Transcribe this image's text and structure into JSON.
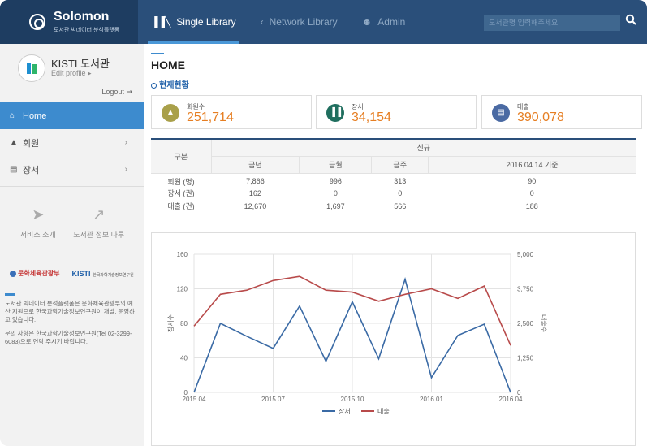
{
  "brand": {
    "title": "Solomon",
    "subtitle": "도서관 빅데이터 분석플랫폼"
  },
  "topnav": {
    "items": [
      {
        "label": "Single Library",
        "icon": "library-books-icon",
        "active": true
      },
      {
        "label": "Network Library",
        "icon": "share-icon",
        "active": false
      },
      {
        "label": "Admin",
        "icon": "user-settings-icon",
        "active": false
      }
    ],
    "search_placeholder": "도서관명 입력해주세요"
  },
  "profile": {
    "name": "KISTI 도서관",
    "edit_label": "Edit profile ▸",
    "logout_label": "Logout"
  },
  "sidebar": {
    "menu": [
      {
        "label": "Home",
        "icon": "home-icon",
        "active": true
      },
      {
        "label": "회원",
        "icon": "user-icon",
        "active": false
      },
      {
        "label": "장서",
        "icon": "book-icon",
        "active": false
      }
    ],
    "quicklinks": [
      {
        "label": "서비스 소개",
        "icon": "paper-plane-icon"
      },
      {
        "label": "도서관 정보 나루",
        "icon": "external-link-icon"
      }
    ],
    "partners": {
      "ministry": "문화체육관광부",
      "kisti": "KISTI",
      "kisti_full": "한국과학기술정보연구원"
    },
    "info": [
      "도서관 빅데이터 분석플랫폼은 문화체육관광부의 예산 지원으로 한국과학기술정보연구원이 개발, 운영하고 있습니다.",
      "문의 사항은 한국과학기술정보연구원(Tel 02-3299-6083)으로 연락 주시기 바랍니다."
    ]
  },
  "main": {
    "title": "HOME",
    "section": "현재현황",
    "stats": [
      {
        "label": "회원수",
        "value": "251,714",
        "color": "#a9a04a",
        "text_color": "#e67e22",
        "icon": "person-icon"
      },
      {
        "label": "장서",
        "value": "34,154",
        "color": "#1f6e5e",
        "text_color": "#e67e22",
        "icon": "books-icon"
      },
      {
        "label": "대출",
        "value": "390,078",
        "color": "#4a6aa3",
        "text_color": "#e67e22",
        "icon": "book-loan-icon"
      }
    ],
    "table": {
      "rowhead": "구분",
      "group": "신규",
      "columns": [
        "금년",
        "금월",
        "금주",
        "2016.04.14 기준"
      ],
      "rows": [
        {
          "label": "회원 (명)",
          "values": [
            "7,866",
            "996",
            "313",
            "90"
          ]
        },
        {
          "label": "장서 (권)",
          "values": [
            "162",
            "0",
            "0",
            "0"
          ]
        },
        {
          "label": "대출 (건)",
          "values": [
            "12,670",
            "1,697",
            "566",
            "188"
          ]
        }
      ]
    }
  },
  "chart_data": {
    "type": "line",
    "x": [
      "2015.04",
      "2015.05",
      "2015.06",
      "2015.07",
      "2015.08",
      "2015.09",
      "2015.10",
      "2015.11",
      "2015.12",
      "2016.01",
      "2016.02",
      "2016.03",
      "2016.04"
    ],
    "x_ticks": [
      "2015.04",
      "2015.07",
      "2015.10",
      "2016.01",
      "2016.04"
    ],
    "ylabel_left": "장서수",
    "ylabel_right": "대출수",
    "yticks_left": [
      "0",
      "40",
      "80",
      "120",
      "160"
    ],
    "yticks_right": [
      "0",
      "1,250",
      "2,500",
      "3,750",
      "5,000"
    ],
    "ylim_left": [
      0,
      160
    ],
    "ylim_right": [
      0,
      5000
    ],
    "grid": true,
    "legend_position": "bottom",
    "series": [
      {
        "name": "장서",
        "axis": "left",
        "color": "#3a6aa5",
        "values": [
          0,
          80,
          65,
          51,
          100,
          36,
          105,
          39,
          131,
          17,
          66,
          79,
          0
        ]
      },
      {
        "name": "대출",
        "axis": "right",
        "color": "#b84a4a",
        "values": [
          2400,
          3550,
          3700,
          4050,
          4200,
          3700,
          3630,
          3300,
          3550,
          3750,
          3400,
          3850,
          1700
        ]
      }
    ]
  }
}
